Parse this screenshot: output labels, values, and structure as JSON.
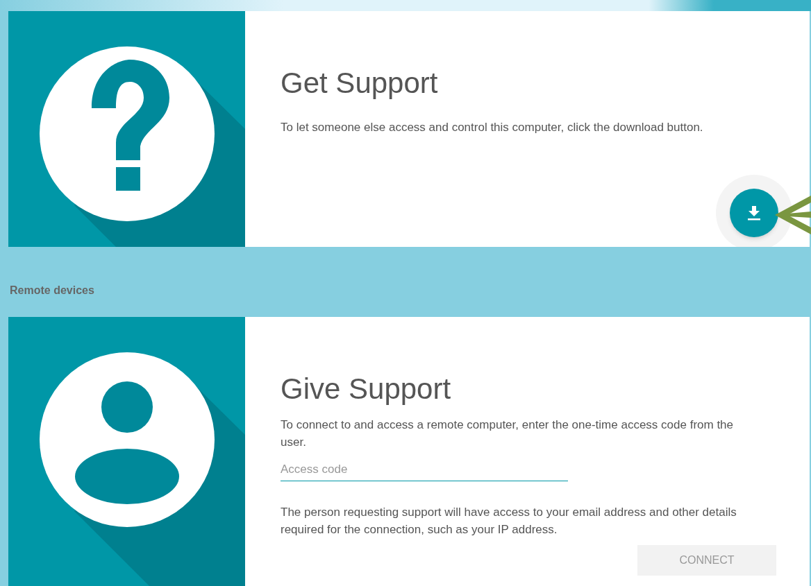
{
  "get_support": {
    "title": "Get Support",
    "description": "To let someone else access and control this computer, click the download button."
  },
  "section_label": "Remote devices",
  "give_support": {
    "title": "Give Support",
    "description": "To connect to and access a remote computer, enter the one-time access code from the user.",
    "access_field": {
      "placeholder": "Access code"
    },
    "note": "The person requesting support will have access to your email address and other details required for the connection, such as your IP address.",
    "connect_button": {
      "label": "CONNECT",
      "disabled": true
    }
  }
}
